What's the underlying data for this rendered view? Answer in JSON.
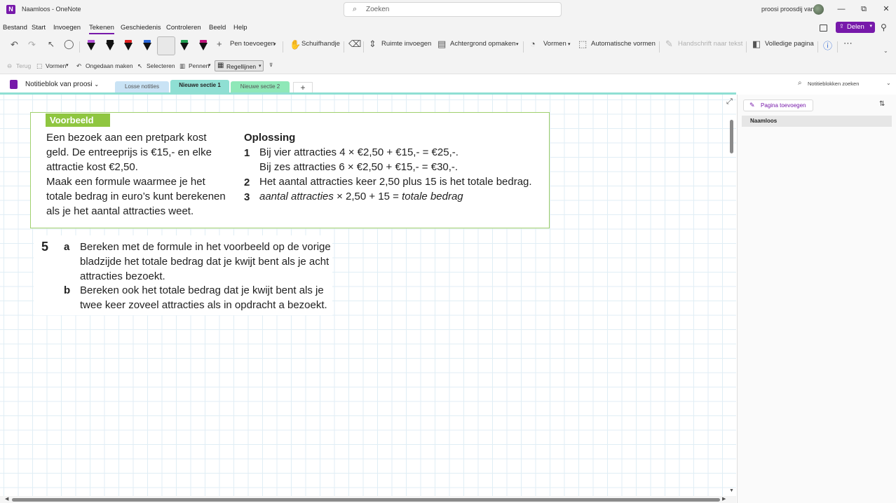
{
  "window": {
    "title": "Naamloos  -  OneNote",
    "search_placeholder": "Zoeken",
    "user": "proosi proosdij van",
    "controls": {
      "minimize": "—",
      "restore": "⧉",
      "close": "✕"
    }
  },
  "menu": {
    "items": [
      "Bestand",
      "Start",
      "Invoegen",
      "Tekenen",
      "Geschiedenis",
      "Controleren",
      "Beeld",
      "Help"
    ],
    "active": "Tekenen",
    "share_label": "Delen"
  },
  "ribbon": {
    "pens": [
      {
        "name": "pen-purple-highlighter",
        "color": "#b24fd6"
      },
      {
        "name": "pen-black",
        "color": "#111111"
      },
      {
        "name": "pen-red",
        "color": "#e02020"
      },
      {
        "name": "pen-blue",
        "color": "#2a66d8"
      },
      {
        "name": "pen-yellow-highlighter",
        "color": "#f6f200"
      },
      {
        "name": "pen-green",
        "color": "#20a050"
      },
      {
        "name": "pen-magenta",
        "color": "#c0147a"
      }
    ],
    "add_pen": "Pen toevoegen",
    "hand": "Schuifhandje",
    "insert_space": "Ruimte invoegen",
    "background": "Achtergrond opmaken",
    "shapes": "Vormen",
    "auto_shapes": "Automatische vormen",
    "ink_to_text": "Handschrift naar tekst",
    "full_page": "Volledige pagina"
  },
  "qat": {
    "back": "Terug",
    "shapes": "Vormen",
    "undo": "Ongedaan maken",
    "select": "Selecteren",
    "pens": "Pennen",
    "ruled": "Regellijnen"
  },
  "notebook": {
    "name": "Notitieblok van proosi",
    "tabs": [
      {
        "label": "Losse notities",
        "color": "#c9e3f5"
      },
      {
        "label": "Nieuwe sectie 1",
        "color": "#8fdfd3"
      },
      {
        "label": "Nieuwe sectie 2",
        "color": "#8fe8b8"
      }
    ],
    "add_tab": "+",
    "search_notebooks": "Notitieblokken zoeken"
  },
  "page": {
    "example_label": "Voorbeeld",
    "question_lines": [
      "Een bezoek aan een pretpark kost",
      "geld. De entreeprijs is €15,- en elke",
      "attractie kost €2,50.",
      "Maak een formule waarmee je het",
      "totale bedrag in euro’s kunt berekenen",
      "als je het aantal attracties weet."
    ],
    "solution_title": "Oplossing",
    "solution": [
      {
        "num": "1",
        "line1": "Bij vier attracties 4 × €2,50 + €15,- = €25,-.",
        "line2": "Bij zes attracties 6 × €2,50 + €15,- = €30,-."
      },
      {
        "num": "2",
        "line1": "Het aantal attracties keer 2,50 plus 15 is het totale bedrag."
      },
      {
        "num": "3",
        "italic1": "aantal attracties",
        "mid": " × 2,50 + 15 = ",
        "italic2": "totale bedrag"
      }
    ],
    "exercise_number": "5",
    "exercise": {
      "a_label": "a",
      "a_lines": [
        "Bereken met de formule in het voorbeeld op de vorige",
        "bladzijde het totale bedrag dat je kwijt bent als je acht",
        "attracties bezoekt."
      ],
      "b_label": "b",
      "b_lines": [
        "Bereken ook het totale bedrag dat je kwijt bent als je",
        "twee keer zoveel attracties als in opdracht a bezoekt."
      ]
    }
  },
  "pane": {
    "add_page": "Pagina toevoegen",
    "pages": [
      "Naamloos"
    ]
  }
}
